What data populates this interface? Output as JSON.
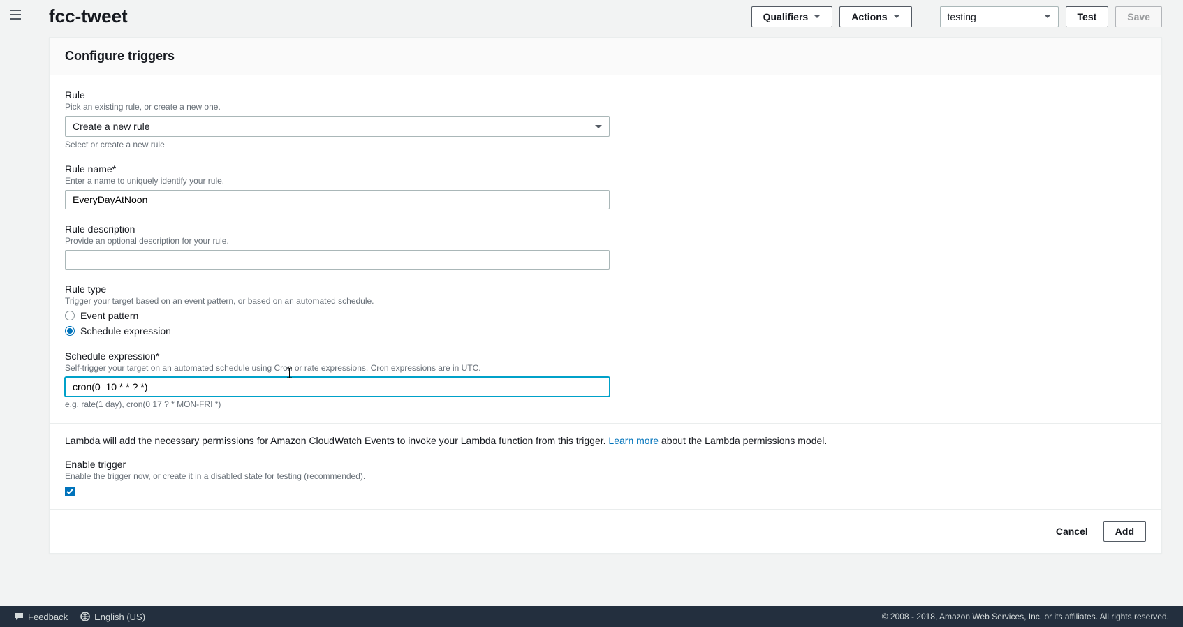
{
  "header": {
    "title": "fcc-tweet",
    "qualifiers_label": "Qualifiers",
    "actions_label": "Actions",
    "test_select_value": "testing",
    "test_label": "Test",
    "save_label": "Save"
  },
  "panel": {
    "title": "Configure triggers"
  },
  "rule": {
    "label": "Rule",
    "hint": "Pick an existing rule, or create a new one.",
    "value": "Create a new rule",
    "below": "Select or create a new rule"
  },
  "rule_name": {
    "label": "Rule name*",
    "hint": "Enter a name to uniquely identify your rule.",
    "value": "EveryDayAtNoon"
  },
  "rule_desc": {
    "label": "Rule description",
    "hint": "Provide an optional description for your rule.",
    "value": ""
  },
  "rule_type": {
    "label": "Rule type",
    "hint": "Trigger your target based on an event pattern, or based on an automated schedule.",
    "option_event": "Event pattern",
    "option_schedule": "Schedule expression"
  },
  "schedule": {
    "label": "Schedule expression*",
    "hint": "Self-trigger your target on an automated schedule using Cron or rate expressions. Cron expressions are in UTC.",
    "value": "cron(0  10 * * ? *)",
    "below": "e.g. rate(1 day), cron(0 17 ? * MON-FRI *)"
  },
  "info": {
    "prefix": "Lambda will add the necessary permissions for Amazon CloudWatch Events to invoke your Lambda function from this trigger. ",
    "link": "Learn more",
    "suffix": " about the Lambda permissions model."
  },
  "enable": {
    "label": "Enable trigger",
    "hint": "Enable the trigger now, or create it in a disabled state for testing (recommended)."
  },
  "footer_buttons": {
    "cancel": "Cancel",
    "add": "Add"
  },
  "bottombar": {
    "feedback": "Feedback",
    "language": "English (US)",
    "copyright": "© 2008 - 2018, Amazon Web Services, Inc. or its affiliates. All rights reserved."
  }
}
